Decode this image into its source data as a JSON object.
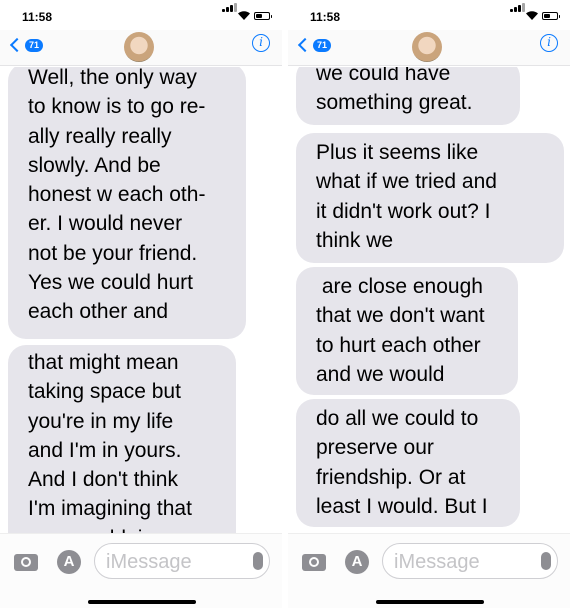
{
  "screens": [
    {
      "time": "11:58",
      "back_badge": "71",
      "bubbles": [
        "Well, the only way\nto know is to go re-\nally really really\nslowly. And be\nhonest w each oth-\ner. I would never\nnot be your friend.\nYes we could hurt\neach other and",
        "that might mean\ntaking space but\nyou're in my life\nand I'm in yours.\nAnd I don't think\nI'm imagining that\n          ould  i"
      ],
      "composer_placeholder": "iMessage"
    },
    {
      "time": "11:58",
      "back_badge": "71",
      "bubbles": [
        "we could have\nsomething great.",
        "Plus it seems like\nwhat if we tried and\nit didn't work out? I\nthink we",
        " are close enough\nthat we don't want\nto hurt each other\nand we would",
        "do all we could to\npreserve our\nfriendship. Or at\nleast I would. But I"
      ],
      "composer_placeholder": "iMessage"
    }
  ]
}
